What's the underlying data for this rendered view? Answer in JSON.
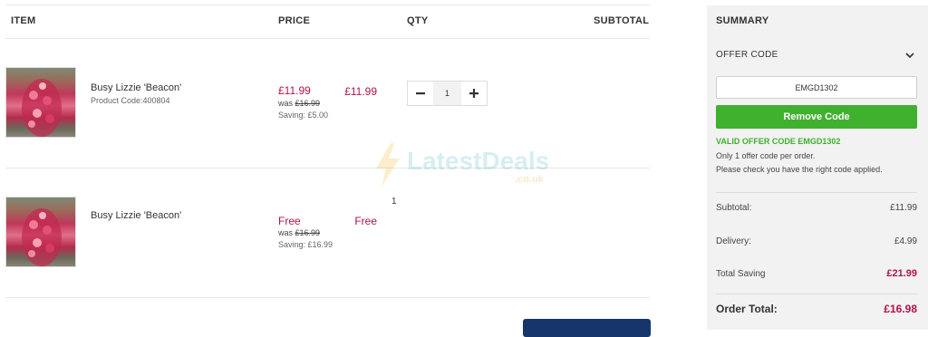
{
  "table": {
    "headers": {
      "item": "ITEM",
      "price": "PRICE",
      "qty": "QTY",
      "subtotal": "SUBTOTAL"
    }
  },
  "items": [
    {
      "name": "Busy Lizzie 'Beacon'",
      "code": "Product Code:400804",
      "price": "£11.99",
      "was_label": "was",
      "was_price": "£16.99",
      "saving": "Saving: £5.00",
      "qty": "1",
      "subtotal": "£11.99",
      "decrease_icon": "minus-icon",
      "increase_icon": "plus-icon"
    },
    {
      "name": "Busy Lizzie 'Beacon'",
      "price": "Free",
      "was_label": "was",
      "was_price": "£16.99",
      "saving": "Saving: £16.99",
      "qty": "1",
      "subtotal": "Free"
    }
  ],
  "watermark": {
    "text": "LatestDeals",
    "sub": ".co.uk",
    "icon": "lightning-bolt-icon"
  },
  "summary": {
    "title": "SUMMARY",
    "offer_code_label": "OFFER CODE",
    "offer_code_value": "EMGD1302",
    "remove_button": "Remove Code",
    "valid_message": "VALID OFFER CODE EMGD1302",
    "note_1": "Only 1 offer code per order.",
    "note_2": "Please check you have the right code applied.",
    "subtotal_label": "Subtotal:",
    "subtotal_value": "£11.99",
    "delivery_label": "Delivery:",
    "delivery_value": "£4.99",
    "saving_label": "Total Saving",
    "saving_value": "£21.99",
    "total_label": "Order Total:",
    "total_value": "£16.98"
  },
  "colors": {
    "price": "#b3124f",
    "green": "#40b02f",
    "navy": "#16366b",
    "panel": "#f2f2f2"
  }
}
